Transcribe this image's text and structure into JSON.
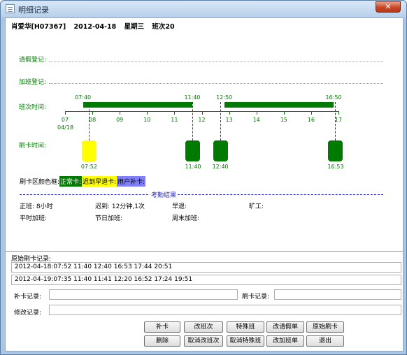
{
  "window": {
    "title": "明细记录",
    "close_label": "✕"
  },
  "header": {
    "name_id": "肖爱华[H07367]",
    "date": "2012-04-18",
    "weekday": "星期三",
    "shift": "班次20"
  },
  "rows": {
    "leave_label": "请假登记:",
    "overtime_label": "加班登记:",
    "shift_time_label": "班次时间:",
    "swipe_time_label": "刷卡时间:"
  },
  "timeline": {
    "axis_ticks": [
      "07",
      "08",
      "09",
      "10",
      "11",
      "12",
      "13",
      "14",
      "15",
      "16",
      "17"
    ],
    "axis_date": "04/18",
    "shift_bars": [
      {
        "start": "07:40",
        "end": "11:40",
        "start_h": 7.667,
        "end_h": 11.667
      },
      {
        "start": "12:50",
        "end": "16:50",
        "start_h": 12.833,
        "end_h": 16.833
      }
    ],
    "swipes": [
      {
        "time": "07:52",
        "hour": 7.867,
        "color": "#ffff00"
      },
      {
        "time": "11:40",
        "hour": 11.667,
        "color": "#007a00"
      },
      {
        "time": "12:40",
        "hour": 12.667,
        "color": "#007a00"
      },
      {
        "time": "16:53",
        "hour": 16.883,
        "color": "#007a00"
      }
    ]
  },
  "legend": {
    "label": "刷卡区颜色框:",
    "items": [
      {
        "text": "正常卡:",
        "bg": "#007a00",
        "fg": "#ffffff"
      },
      {
        "text": "迟到早退卡:",
        "bg": "#ffff00",
        "fg": "#000000"
      },
      {
        "text": "用户补卡:",
        "bg": "#8080ff",
        "fg": "#000000"
      }
    ]
  },
  "attendance": {
    "title": "考勤结果",
    "normal": "正班:  8小时",
    "late": "迟到:  12分钟,1次",
    "early": "早退:",
    "absent": "旷工:",
    "weekday_ot": "平时加班:",
    "holiday_ot": "节日加班:",
    "weekend_ot": "周末加班:"
  },
  "raw_log": {
    "title": "原始刷卡记录:",
    "lines": [
      "2012-04-18:07:52 11:40 12:40 16:53 17:44 20:51",
      "2012-04-19:07:35 11:40 11:41 12:20 16:52 17:24 19:51"
    ]
  },
  "fields": {
    "supplement_label": "补卡记录:",
    "swipe_label": "刷卡记录:",
    "modify_label": "修改记录:"
  },
  "buttons": {
    "supplement": "补卡",
    "change_shift": "改班次",
    "special_shift": "特殊班",
    "change_leave": "改请假单",
    "raw_swipe": "原始刷卡",
    "delete": "删除",
    "cancel_change_shift": "取消改班次",
    "cancel_special": "取消特殊班",
    "change_overtime": "改加班单",
    "exit": "退出"
  }
}
